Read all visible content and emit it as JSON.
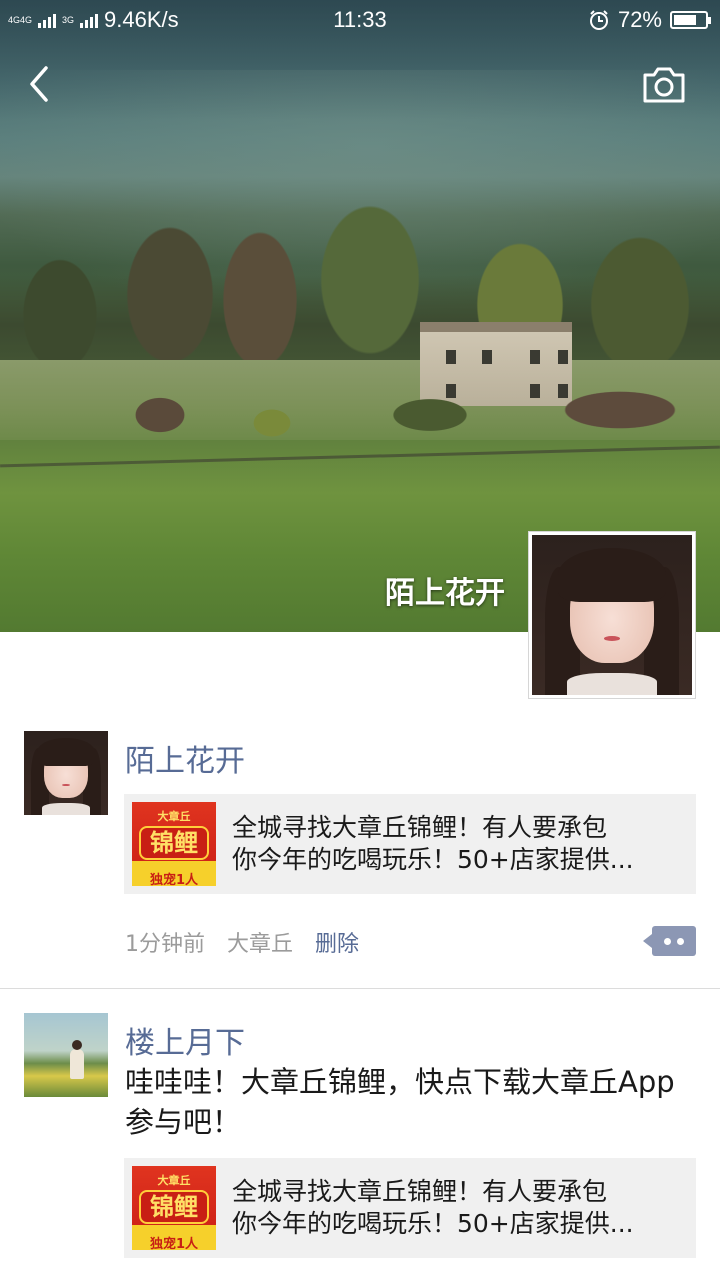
{
  "status_bar": {
    "net_left": "4G",
    "net_mid": "4G",
    "net_right": "3G",
    "speed": "9.46K/s",
    "time": "11:33",
    "battery": "72%",
    "battery_level": 0.72
  },
  "profile": {
    "name": "陌上花开"
  },
  "posts": [
    {
      "author": "陌上花开",
      "link": {
        "thumb_top": "大章丘",
        "thumb_main": "锦鲤",
        "thumb_bottom": "独宠1人",
        "title_line1": "全城寻找大章丘锦鲤！有人要承包",
        "title_line2": "你今年的吃喝玩乐！50+店家提供..."
      },
      "time": "1分钟前",
      "location": "大章丘",
      "delete_label": "删除"
    },
    {
      "author": "楼上月下",
      "text": "哇哇哇！大章丘锦鲤，快点下载大章丘App参与吧！",
      "link": {
        "thumb_top": "大章丘",
        "thumb_main": "锦鲤",
        "thumb_bottom": "独宠1人",
        "title_line1": "全城寻找大章丘锦鲤！有人要承包",
        "title_line2": "你今年的吃喝玩乐！50+店家提供..."
      }
    }
  ]
}
